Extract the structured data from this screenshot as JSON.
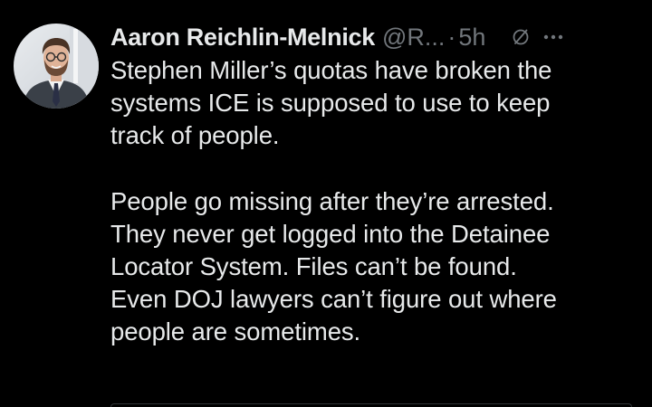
{
  "author": {
    "display_name": "Aaron Reichlin-Melnick",
    "handle": "@R...",
    "separator": "·",
    "time": "5h"
  },
  "icons": {
    "grok": "grok-slash-circle-icon",
    "more": "more-horizontal-icon"
  },
  "post": {
    "paragraph1": [
      "Stephen Miller’s quotas have broken the",
      "systems ICE is supposed to use to keep",
      "track of people."
    ],
    "paragraph2": [
      "People go missing after they’re arrested.",
      "They never get logged into the Detainee",
      "Locator System. Files can’t be found.",
      "Even DOJ lawyers can’t figure out where",
      "people are sometimes."
    ]
  },
  "colors": {
    "background": "#000000",
    "primary_text": "#e7e9ea",
    "secondary_text": "#71767b"
  }
}
